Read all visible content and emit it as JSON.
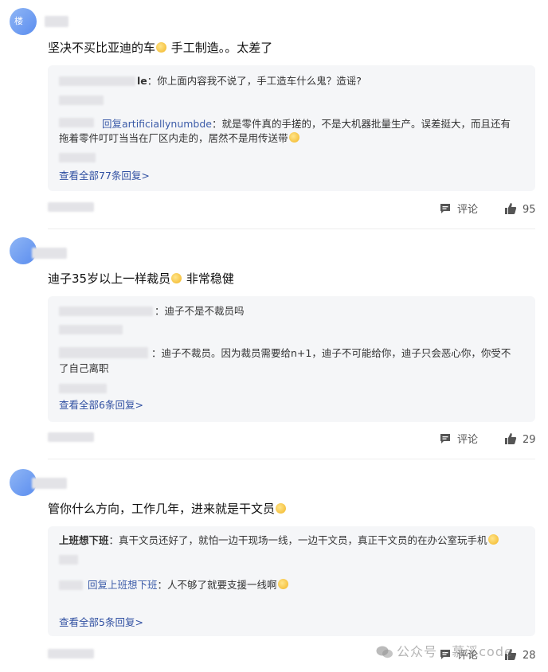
{
  "posts": [
    {
      "avatar_text": "楼",
      "text": "坚决不买比亚迪的车",
      "text_after": " 手工制造。。太差了",
      "replies": [
        {
          "name": "le",
          "link": "",
          "text": "：你上面内容我不说了，手工造车什么鬼？造谣?"
        },
        {
          "name": "",
          "link": "回复artificiallynumbde",
          "text": "：就是零件真的手搓的，不是大机器批量生产。误差挺大，而且还有",
          "text2": "拖着零件叮叮当当在厂区内走的，居然不是用传送带"
        }
      ],
      "view_all": "查看全部77条回复>",
      "comment_label": "评论",
      "likes": "95"
    },
    {
      "avatar_text": "",
      "text": "迪子35岁以上一样裁员",
      "text_after": " 非常稳健",
      "replies": [
        {
          "name": "",
          "link": "",
          "text": "：迪子不是不裁员吗"
        },
        {
          "name": "",
          "link": "",
          "text": "：迪子不裁员。因为裁员需要给n+1，迪子不可能给你，迪子只会恶心你，你受不",
          "text2": "了自己离职"
        }
      ],
      "view_all": "查看全部6条回复>",
      "comment_label": "评论",
      "likes": "29"
    },
    {
      "avatar_text": "",
      "text": "管你什么方向，工作几年，进来就是干文员",
      "text_after": "",
      "replies": [
        {
          "name": "上班想下班",
          "link": "",
          "text": "：真干文员还好了，就怕一边干现场一线，一边干文员，真正干文员的在办公室玩手机"
        },
        {
          "name": "",
          "link": "回复上班想下班",
          "text": "：人不够了就要支援一线啊"
        }
      ],
      "view_all": "查看全部5条回复>",
      "comment_label": "评论",
      "likes": "28"
    }
  ],
  "watermark": "公众号 · 慕溪code"
}
